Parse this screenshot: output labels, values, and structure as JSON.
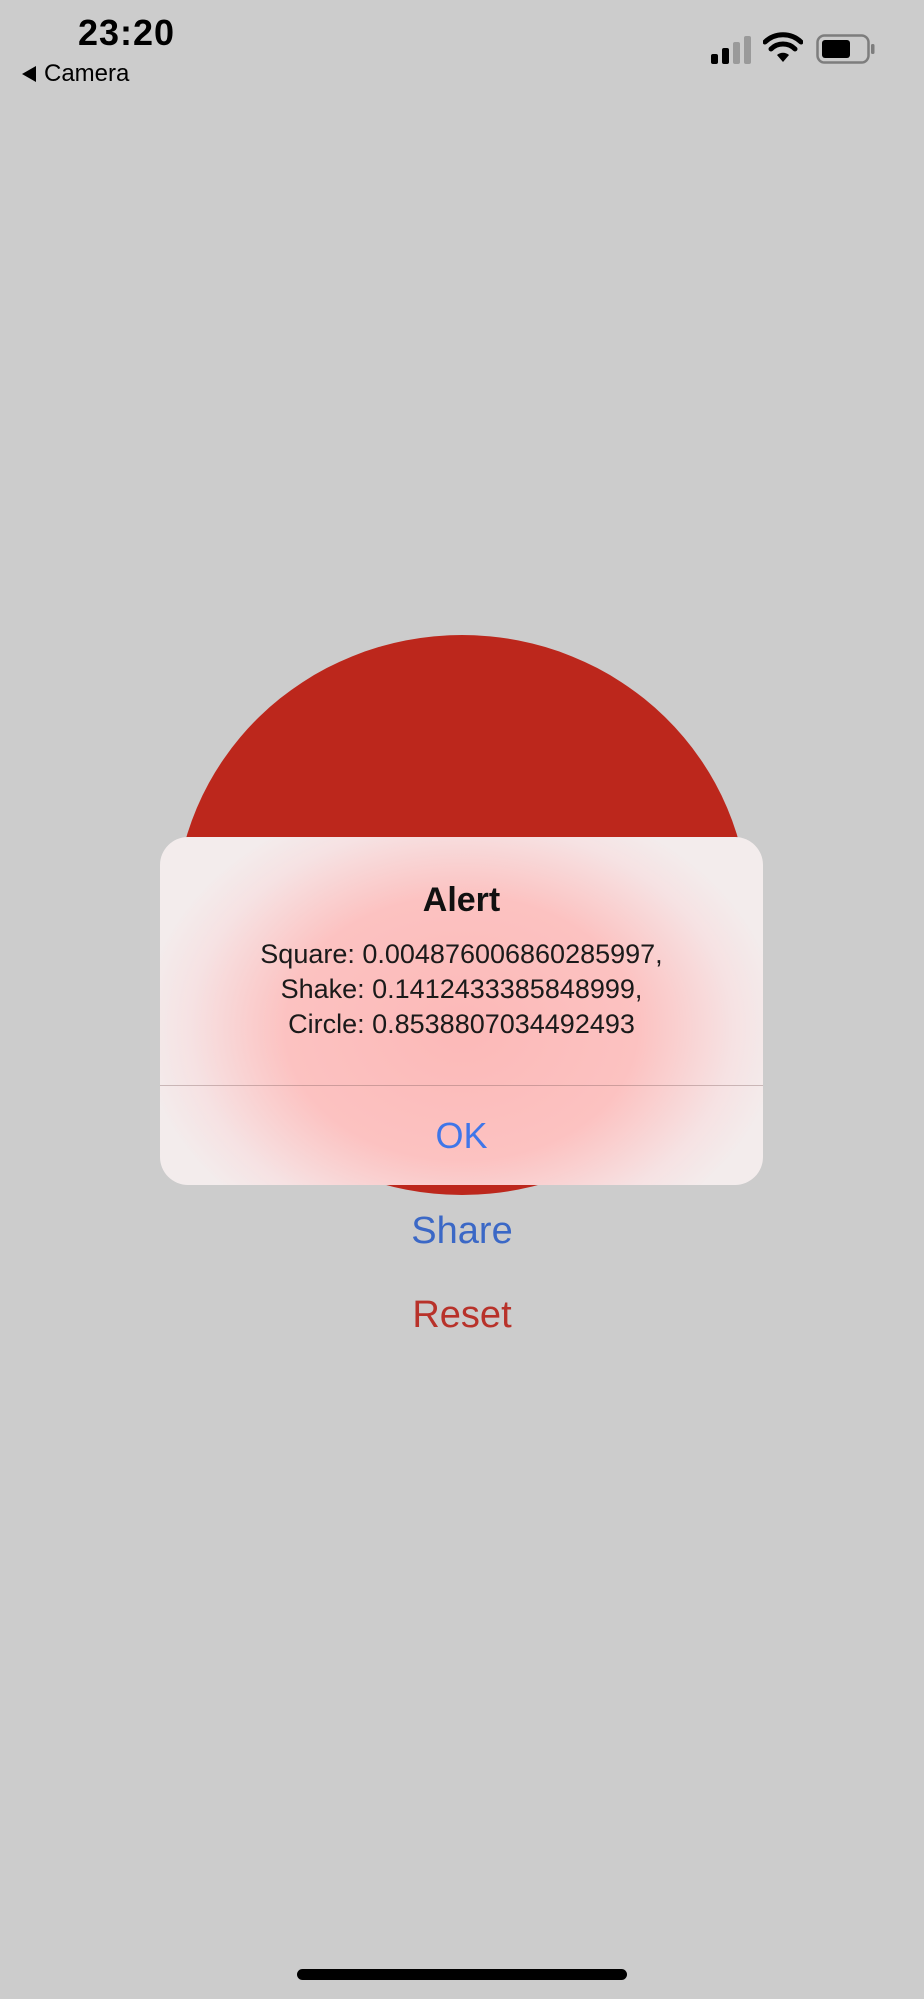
{
  "status_bar": {
    "time": "23:20",
    "back_label": "Camera"
  },
  "main": {
    "share_label": "Share",
    "reset_label": "Reset",
    "circle_color": "#bc271c"
  },
  "alert": {
    "title": "Alert",
    "lines": [
      "Square: 0.004876006860285997,",
      "Shake: 0.1412433385848999,",
      "Circle: 0.8538807034492493"
    ],
    "ok_label": "OK"
  },
  "colors": {
    "background": "#cccccc",
    "share": "#3b68c6",
    "reset": "#b8322a",
    "ok": "#3f76e9"
  },
  "icons": [
    "back-arrow-icon",
    "signal-icon",
    "wifi-icon",
    "battery-icon"
  ]
}
